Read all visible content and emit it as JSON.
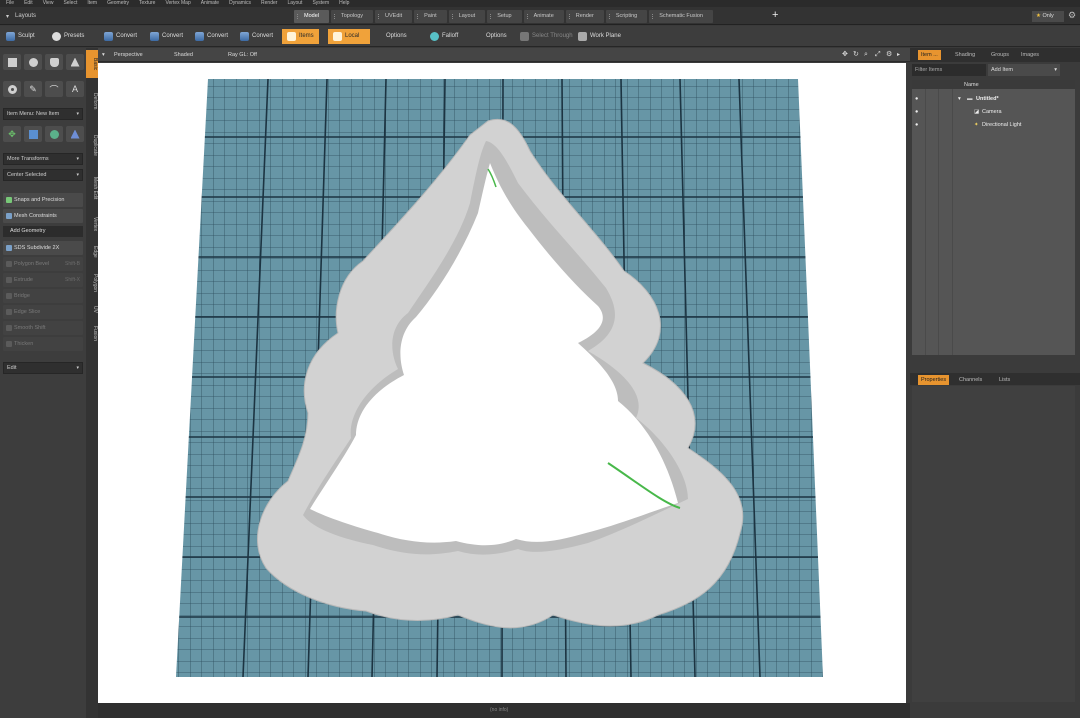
{
  "menubar": [
    "File",
    "Edit",
    "View",
    "Select",
    "Item",
    "Geometry",
    "Texture",
    "Vertex Map",
    "Animate",
    "Dynamics",
    "Render",
    "Layout",
    "System",
    "Help"
  ],
  "layouts_label": "Layouts",
  "layout_tabs": [
    {
      "label": "Model",
      "active": true
    },
    {
      "label": "Topology",
      "active": false
    },
    {
      "label": "UVEdit",
      "active": false
    },
    {
      "label": "Paint",
      "active": false
    },
    {
      "label": "Layout",
      "active": false
    },
    {
      "label": "Setup",
      "active": false
    },
    {
      "label": "Animate",
      "active": false
    },
    {
      "label": "Render",
      "active": false
    },
    {
      "label": "Scripting",
      "active": false
    },
    {
      "label": "Schematic Fusion",
      "active": false
    }
  ],
  "only_label": "Only",
  "toolbar": {
    "sculpt": "Sculpt",
    "presets": "Presets",
    "convert1": "Convert",
    "convert2": "Convert",
    "convert3": "Convert",
    "convert4": "Convert",
    "items": "Items",
    "local": "Local",
    "options1": "Options",
    "falloff": "Falloff",
    "options2": "Options",
    "select_through": "Select Through",
    "work_plane": "Work Plane"
  },
  "left_panel": {
    "item_menu": "Item Menu: New Item",
    "more_transforms": "More Transforms",
    "center_selected": "Center Selected",
    "snaps": "Snaps and Precision",
    "mesh_constraints": "Mesh Constraints",
    "add_geometry": "Add Geometry",
    "sds_subdivide": "SDS Subdivide 2X",
    "tools": [
      {
        "label": "Polygon Bevel",
        "shortcut": "Shift-B"
      },
      {
        "label": "Extrude",
        "shortcut": "Shift-X"
      },
      {
        "label": "Bridge",
        "shortcut": ""
      },
      {
        "label": "Edge Slice",
        "shortcut": ""
      },
      {
        "label": "Smooth Shift",
        "shortcut": ""
      },
      {
        "label": "Thicken",
        "shortcut": ""
      }
    ],
    "edit": "Edit"
  },
  "vertical_tabs": [
    "Basic",
    "Deform",
    "Duplicate",
    "Mesh Edit",
    "Vertex",
    "Edge",
    "Polygon",
    "UV",
    "Fusion"
  ],
  "viewport": {
    "view": "Perspective",
    "shading": "Shaded",
    "raygl": "Ray GL: Off",
    "status": "(no info)"
  },
  "right_panel": {
    "tabs": [
      "Item ...",
      "Shading",
      "Groups",
      "Images"
    ],
    "filter_placeholder": "Filter Items",
    "add_item": "Add Item",
    "name_header": "Name",
    "scene": "Untitled*",
    "items": [
      "Camera",
      "Directional Light"
    ],
    "bottom_tabs": [
      "Properties",
      "Channels",
      "Lists"
    ]
  },
  "colors": {
    "accent": "#e7942f",
    "grid_base": "#5f8fa0",
    "grid_line": "#1f3c4b",
    "cutter": "#d4d4d4",
    "edge_highlight": "#48b84a"
  }
}
